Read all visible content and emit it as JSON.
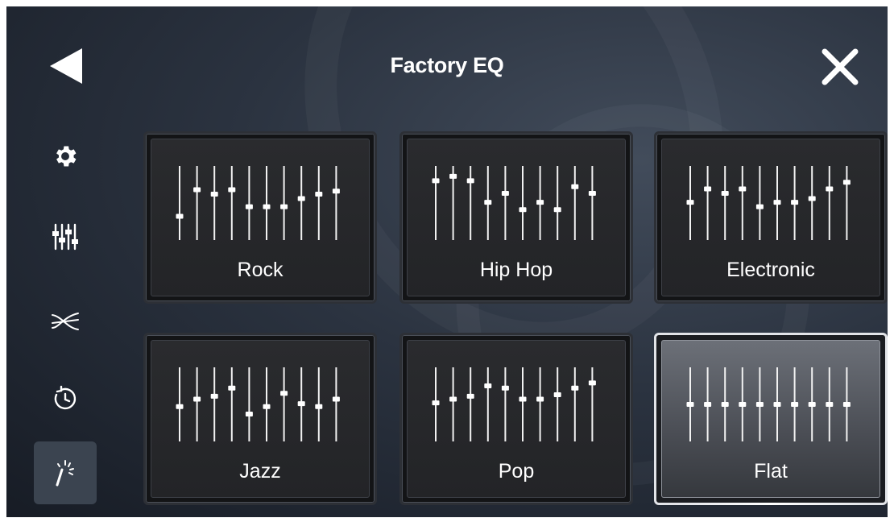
{
  "header": {
    "title": "Factory EQ",
    "back_icon": "back-arrow-icon",
    "close_icon": "close-icon"
  },
  "sidebar": {
    "items": [
      {
        "name": "settings",
        "icon": "gear-icon",
        "active": false
      },
      {
        "name": "equalizer",
        "icon": "sliders-icon",
        "active": false
      },
      {
        "name": "crossover",
        "icon": "crossover-icon",
        "active": false
      },
      {
        "name": "time-alignment",
        "icon": "time-restore-icon",
        "active": false
      },
      {
        "name": "factory-eq",
        "icon": "magic-wand-icon",
        "active": true
      }
    ]
  },
  "presets": [
    {
      "label": "Rock",
      "selected": false,
      "levels": [
        0.32,
        0.68,
        0.62,
        0.68,
        0.45,
        0.45,
        0.45,
        0.56,
        0.62,
        0.66
      ]
    },
    {
      "label": "Hip Hop",
      "selected": false,
      "levels": [
        0.8,
        0.86,
        0.8,
        0.51,
        0.63,
        0.41,
        0.51,
        0.41,
        0.72,
        0.63
      ]
    },
    {
      "label": "Electronic",
      "selected": false,
      "levels": [
        0.51,
        0.69,
        0.63,
        0.69,
        0.45,
        0.51,
        0.51,
        0.56,
        0.69,
        0.78
      ]
    },
    {
      "label": "Jazz",
      "selected": false,
      "levels": [
        0.47,
        0.57,
        0.61,
        0.72,
        0.37,
        0.47,
        0.65,
        0.51,
        0.47,
        0.57
      ]
    },
    {
      "label": "Pop",
      "selected": false,
      "levels": [
        0.52,
        0.57,
        0.61,
        0.75,
        0.72,
        0.57,
        0.57,
        0.63,
        0.72,
        0.79
      ]
    },
    {
      "label": "Flat",
      "selected": true,
      "levels": [
        0.5,
        0.5,
        0.5,
        0.5,
        0.5,
        0.5,
        0.5,
        0.5,
        0.5,
        0.5
      ]
    }
  ]
}
